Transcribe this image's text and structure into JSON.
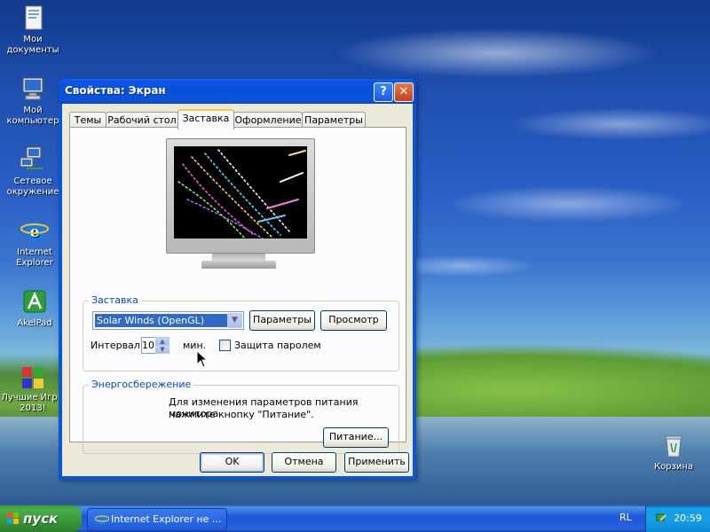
{
  "desktop": {
    "icons": [
      {
        "label": "Мои документы"
      },
      {
        "label": "Мой компьютер"
      },
      {
        "label": "Сетевое окружение"
      },
      {
        "label": "Internet Explorer"
      },
      {
        "label": "AkelPad"
      },
      {
        "label": "Лучшие Игры 2013!"
      },
      {
        "label": "Корзина"
      }
    ]
  },
  "window": {
    "title": "Свойства: Экран",
    "help_glyph": "?",
    "close_glyph": "✕",
    "tabs": [
      {
        "label": "Темы"
      },
      {
        "label": "Рабочий стол"
      },
      {
        "label": "Заставка",
        "active": true
      },
      {
        "label": "Оформление"
      },
      {
        "label": "Параметры"
      }
    ],
    "screensaver_group": {
      "legend": "Заставка",
      "selected": "Solar Winds (OpenGL)",
      "settings_button": "Параметры",
      "preview_button": "Просмотр",
      "interval_label": "Интервал:",
      "interval_value": "10",
      "interval_unit": "мин.",
      "password_label": "Защита паролем",
      "password_checked": false
    },
    "power_group": {
      "legend": "Энергосбережение",
      "text_line1": "Для изменения параметров питания монитора",
      "text_line2": "нажмите кнопку \"Питание\".",
      "power_button": "Питание..."
    },
    "buttons": {
      "ok": "OK",
      "cancel": "Отмена",
      "apply": "Применить"
    }
  },
  "taskbar": {
    "start_label": "пуск",
    "task_label": "Internet Explorer не ...",
    "language": "RL",
    "clock": "20:59"
  },
  "colors": {
    "title_blue": "#0a4fd6",
    "start_green": "#3a963a",
    "legend_blue": "#0046d5",
    "selection_blue": "#316ac5"
  }
}
